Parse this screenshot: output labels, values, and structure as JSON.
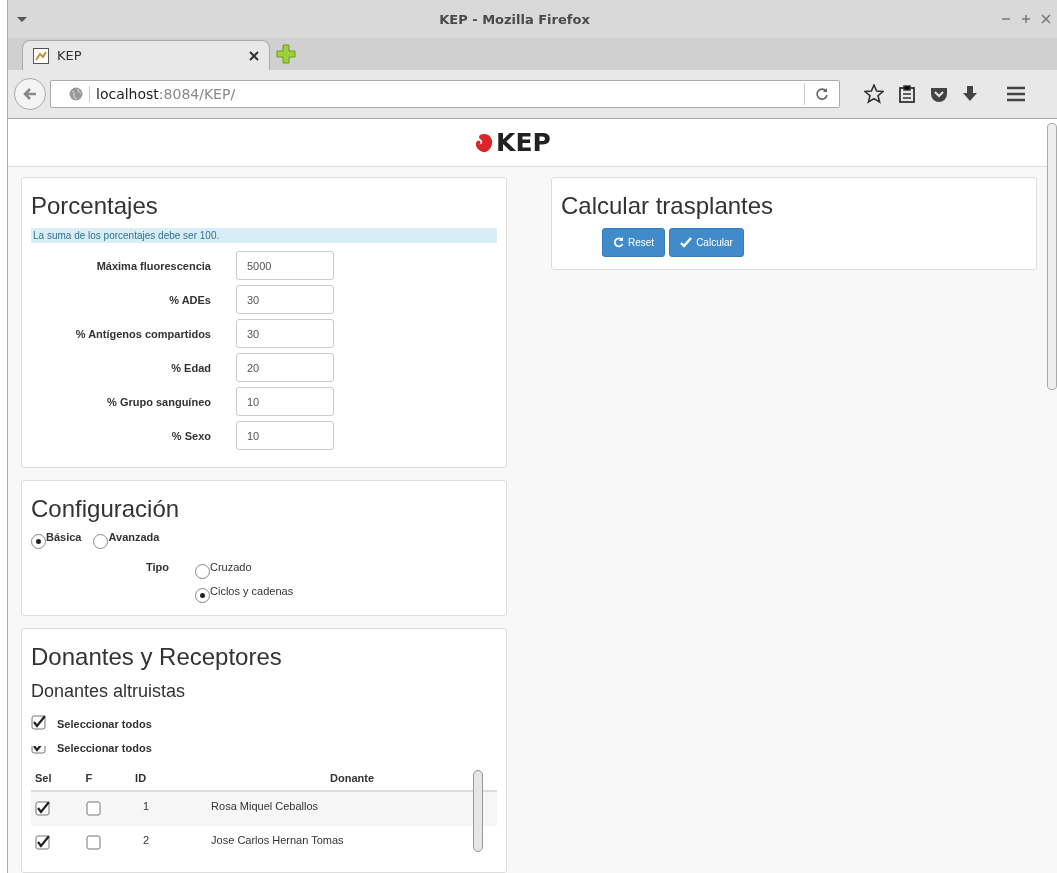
{
  "window": {
    "title": "KEP - Mozilla Firefox"
  },
  "tabs": [
    {
      "label": "KEP",
      "selected": true
    }
  ],
  "address_bar": {
    "host": "localhost",
    "path": ":8084/KEP/"
  },
  "header": {
    "brand": "KEP"
  },
  "porcentajes": {
    "title": "Porcentajes",
    "notice": "La suma de los porcentajes debe ser 100.",
    "fields": [
      {
        "label": "Máxima fluorescencia",
        "value": "5000"
      },
      {
        "label": "% ADEs",
        "value": "30"
      },
      {
        "label": "% Antígenos compartidos",
        "value": "30"
      },
      {
        "label": "% Edad",
        "value": "20"
      },
      {
        "label": "% Grupo sanguíneo",
        "value": "10"
      },
      {
        "label": "% Sexo",
        "value": "10"
      }
    ]
  },
  "configuracion": {
    "title": "Configuración",
    "modes": [
      {
        "label": "Básica",
        "selected": true
      },
      {
        "label": "Avanzada",
        "selected": false
      }
    ],
    "tipo_label": "Tipo",
    "tipos": [
      {
        "label": "Cruzado",
        "selected": false
      },
      {
        "label": "Ciclos y cadenas",
        "selected": true
      }
    ]
  },
  "donantes": {
    "title": "Donantes y Receptores",
    "subtitle": "Donantes altruistas",
    "select_all": [
      {
        "label": "Seleccionar todos",
        "checked": true,
        "kind": "full"
      },
      {
        "label": "Seleccionar todos",
        "checked": true,
        "kind": "clipped"
      }
    ],
    "columns": [
      "Sel",
      "F",
      "ID",
      "Donante"
    ],
    "rows": [
      {
        "sel": true,
        "f": false,
        "id": "1",
        "donante": "Rosa Miquel Ceballos"
      },
      {
        "sel": true,
        "f": false,
        "id": "2",
        "donante": "Jose Carlos Hernan Tomas"
      }
    ]
  },
  "calcular": {
    "title": "Calcular trasplantes",
    "buttons": [
      {
        "label": "Reset",
        "kind": "reset"
      },
      {
        "label": "Calcular",
        "kind": "check"
      }
    ]
  }
}
